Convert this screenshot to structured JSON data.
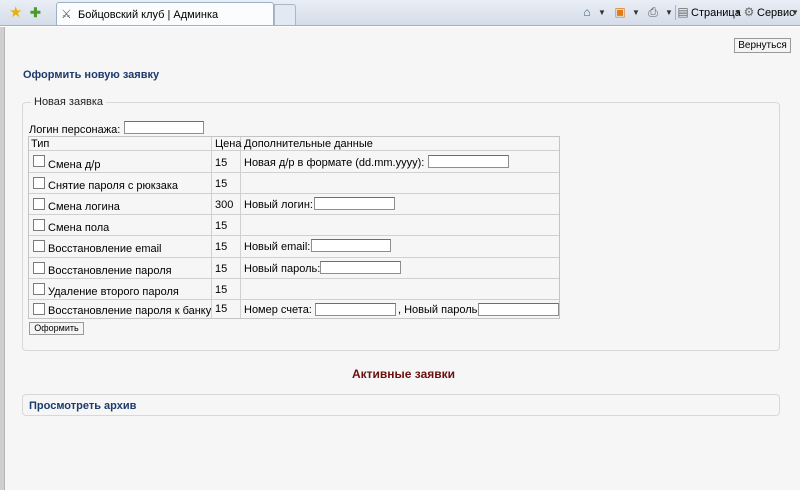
{
  "browser": {
    "tab_title": "Бойцовский клуб | Админка",
    "commands": {
      "page_label": "Страница",
      "tools_label": "Сервис"
    }
  },
  "page": {
    "back_button": "Вернуться",
    "new_request_link": "Оформить новую заявку",
    "fieldset_legend": "Новая заявка",
    "login_label": "Логин персонажа:",
    "login_value": "",
    "table": {
      "headers": [
        "Тип",
        "Цена",
        "Дополнительные данные"
      ],
      "rows": [
        {
          "type": "Смена д/р",
          "price": "15",
          "extra_label": "Новая д/р в формате (dd.mm.yyyy):",
          "checked": false
        },
        {
          "type": "Снятие пароля с рюкзака",
          "price": "15",
          "extra_label": "",
          "checked": false
        },
        {
          "type": "Смена логина",
          "price": "300",
          "extra_label": "Новый логин:",
          "checked": false
        },
        {
          "type": "Смена пола",
          "price": "15",
          "extra_label": "",
          "checked": false
        },
        {
          "type": "Восстановление email",
          "price": "15",
          "extra_label": "Новый email:",
          "checked": false
        },
        {
          "type": "Восстановление пароля",
          "price": "15",
          "extra_label": "Новый пароль:",
          "checked": false
        },
        {
          "type": "Удаление второго пароля",
          "price": "15",
          "extra_label": "",
          "checked": false
        },
        {
          "type": "Восстановление пароля к банку",
          "price": "15",
          "extra_label": "Номер счета:",
          "extra_label_2": ", Новый пароль:",
          "checked": false
        }
      ]
    },
    "submit_button": "Оформить",
    "active_requests_title": "Активные заявки",
    "archive_link": "Просмотреть архив"
  },
  "colors": {
    "link": "#1c3a6b",
    "active_title": "#6b0f0f",
    "page_bg": "#f6f6f6"
  }
}
